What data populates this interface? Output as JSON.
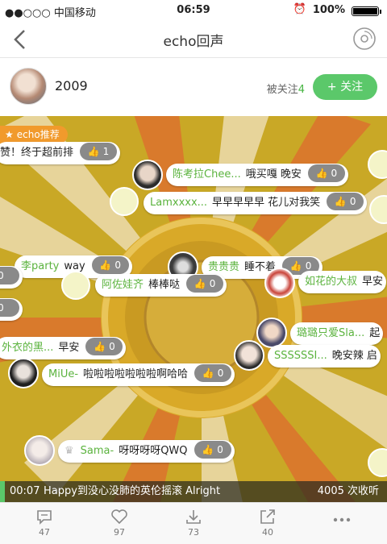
{
  "status_bar": {
    "carrier": "●●○○○ 中国移动",
    "time": "06:59",
    "battery": "100%"
  },
  "nav": {
    "title": "echo回声"
  },
  "user": {
    "name": "2009",
    "followers_label": "被关注",
    "followers_count": "4",
    "follow_button": "+ 关注"
  },
  "stage": {
    "tag": "echo推荐",
    "comments": [
      {
        "name": "",
        "text": "赞！终于超前排",
        "likes": "1"
      },
      {
        "name": "陈考拉Chee...",
        "text": "哦买嘎 晚安",
        "likes": "0"
      },
      {
        "name": "Lamxxxx...",
        "text": "早早早早早 花儿对我笑",
        "likes": "0"
      },
      {
        "name": "李party",
        "text": "way",
        "likes": "0"
      },
      {
        "name": "贵贵贵",
        "text": "睡不着",
        "likes": "0"
      },
      {
        "name": "阿佐娃齐",
        "text": "棒棒哒",
        "likes": "0"
      },
      {
        "name": "如花的大叔",
        "text": "早安",
        "likes": ""
      },
      {
        "name": "外衣的黑...",
        "text": "早安",
        "likes": "0"
      },
      {
        "name": "璐璐只爱Sla...",
        "text": "起",
        "likes": ""
      },
      {
        "name": "SSSSSSI...",
        "text": "晚安辣 启",
        "likes": ""
      },
      {
        "name": "MiUe-",
        "text": "啦啦啦啦啦啦啦啊哈哈",
        "likes": "0"
      },
      {
        "name": "Sama-",
        "text": "呀呀呀呀QWQ",
        "likes": "0"
      }
    ],
    "left_edge_likes": [
      "0",
      "0"
    ]
  },
  "player": {
    "elapsed": "00:07",
    "song": "Happy到没心没肺的英伦摇滚 Alright",
    "plays": "4005 次收听"
  },
  "toolbar": {
    "comments": "47",
    "likes": "97",
    "downloads": "73",
    "shares": "40"
  },
  "colors": {
    "accent_green": "#5bc86a",
    "tag_orange": "#f19a2c",
    "username_green": "#5bb33e"
  }
}
